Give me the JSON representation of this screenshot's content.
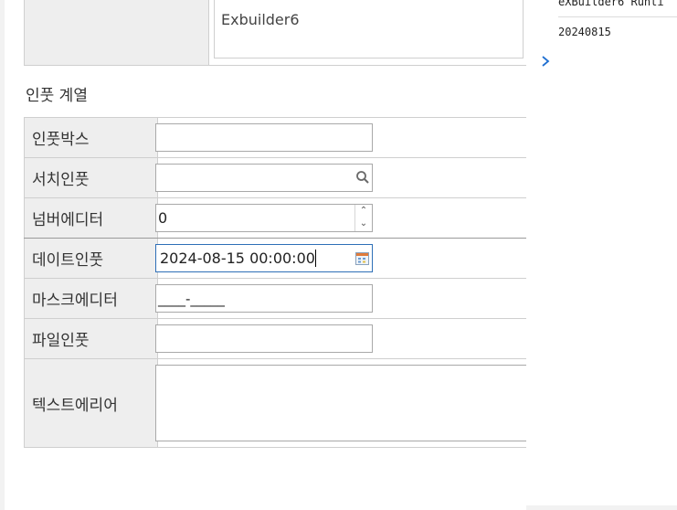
{
  "top": {
    "area_text": "Exbuilder6"
  },
  "section": {
    "title": "인풋 계열"
  },
  "rows": [
    {
      "label": "인풋박스",
      "value": ""
    },
    {
      "label": "서치인풋",
      "value": ""
    },
    {
      "label": "넘버에디터",
      "value": "0"
    },
    {
      "label": "데이트인풋",
      "value": "2024-08-15 00:00:00"
    },
    {
      "label": "마스크에디터",
      "value": "____-_____"
    },
    {
      "label": "파일인풋",
      "value": ""
    },
    {
      "label": "텍스트에리어",
      "value": ""
    }
  ],
  "console": {
    "title": "eXBuilder6 Runti",
    "value": "20240815"
  },
  "icons": {
    "search": "search-icon",
    "calendar": "calendar-icon",
    "spin_up": "chevron-up-icon",
    "spin_down": "chevron-down-icon",
    "expand": "chevron-right-icon"
  },
  "colors": {
    "focus_border": "#2e6fb7",
    "label_bg": "#eeeeee",
    "chevron": "#1f6fd1"
  }
}
